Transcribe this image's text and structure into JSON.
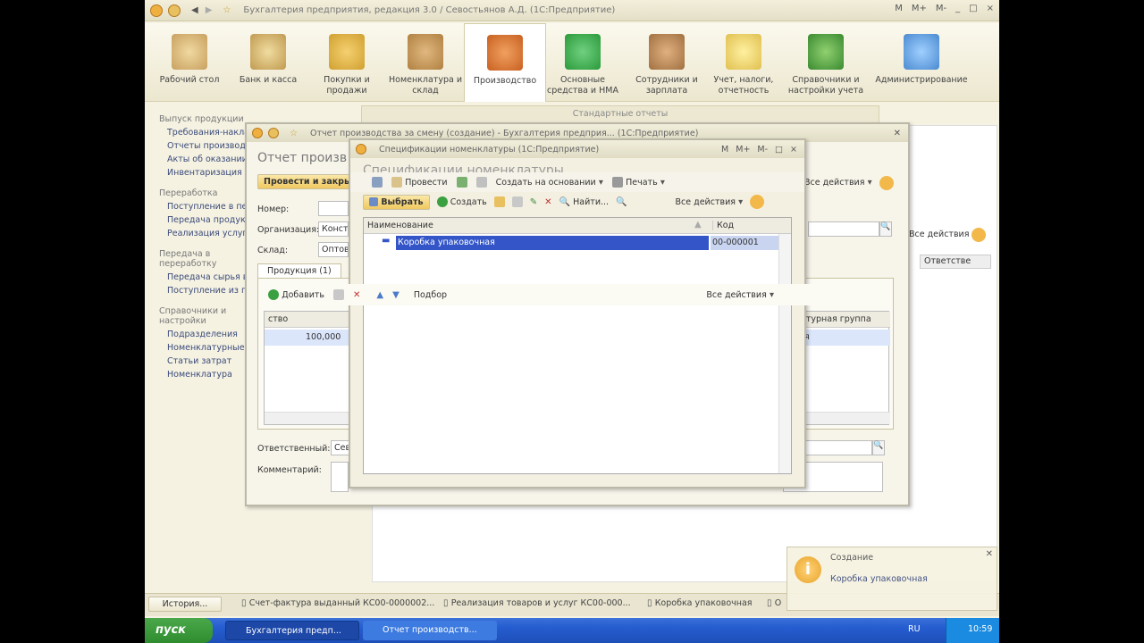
{
  "main_window": {
    "title": "Бухгалтерия предприятия, редакция 3.0 / Севостьянов А.Д. (1С:Предприятие)",
    "controls": [
      "M",
      "M+",
      "M-",
      "_",
      "□",
      "×"
    ]
  },
  "sections": [
    {
      "label": "Рабочий стол",
      "icon": "desk-icon",
      "color": "#c8a060"
    },
    {
      "label": "Банк и касса",
      "icon": "bank-icon",
      "color": "#c09a50"
    },
    {
      "label": "Покупки и продажи",
      "icon": "truck-icon",
      "color": "#d0a030"
    },
    {
      "label": "Номенклатура и склад",
      "icon": "warehouse-icon",
      "color": "#b08040"
    },
    {
      "label": "Производство",
      "icon": "production-icon",
      "color": "#c86020"
    },
    {
      "label": "Основные средства и НМА",
      "icon": "assets-icon",
      "color": "#2a9a3a"
    },
    {
      "label": "Сотрудники и зарплата",
      "icon": "employee-icon",
      "color": "#a07040"
    },
    {
      "label": "Учет, налоги, отчетность",
      "icon": "reports-icon",
      "color": "#e0c050"
    },
    {
      "label": "Справочники и настройки учета",
      "icon": "books-icon",
      "color": "#3a8a30"
    },
    {
      "label": "Администрирование",
      "icon": "admin-icon",
      "color": "#4a8ad0"
    }
  ],
  "nav": [
    {
      "heading": "Выпуск продукции",
      "items": [
        "Требования-накладные",
        "Отчеты производства",
        "Акты об оказании",
        "Инвентаризация"
      ]
    },
    {
      "heading": "Переработка",
      "items": [
        "Поступление в переработку",
        "Передача продукции",
        "Реализация услуг"
      ]
    },
    {
      "heading": "Передача в переработку",
      "items": [
        "Передача сырья в",
        "Поступление из п"
      ]
    },
    {
      "heading": "Справочники и настройки",
      "items": [
        "Подразделения",
        "Номенклатурные",
        "Статьи затрат",
        "Номенклатура"
      ]
    }
  ],
  "background_panel": {
    "title": "Стандартные отчеты",
    "all_actions": "Все действия",
    "col_responsible": "Ответстве"
  },
  "report_window": {
    "title": "Отчет производства за смену (создание) - Бухгалтерия предприя... (1С:Предприятие)",
    "heading": "Отчет произв",
    "post_close_btn": "Провести и закрыть",
    "all_actions": "Все действия",
    "number_label": "Номер:",
    "org_label": "Организация:",
    "org_value": "Конст",
    "warehouse_label": "Склад:",
    "warehouse_value": "Оптов",
    "tab_products": "Продукция (1)",
    "add_btn": "Добавить",
    "pick_btn": "Подбор",
    "table_all_actions": "Все действия",
    "col_qty": "ство",
    "col_group": "атурная группа",
    "row_qty": "100,000",
    "row_group": "я",
    "responsible_label": "Ответственный:",
    "responsible_value": "Сев",
    "comment_label": "Комментарий:"
  },
  "spec_window": {
    "title": "Спецификации номенклатуры (1С:Предприятие)",
    "heading": "Спецификации номенклатуры",
    "toolbar1": {
      "post": "Провести",
      "create_based": "Создать на основании",
      "print": "Печать"
    },
    "toolbar2": {
      "select": "Выбрать",
      "create": "Создать",
      "find": "Найти...",
      "all_actions": "Все действия"
    },
    "columns": [
      "Наименование",
      "Код"
    ],
    "rows": [
      {
        "name": "Коробка упаковочная",
        "code": "00-000001"
      }
    ]
  },
  "history_bar": {
    "button": "История...",
    "items": [
      "Счет-фактура выданный КС00-0000002...",
      "Реализация товаров и услуг КС00-000...",
      "Коробка упаковочная",
      "О"
    ]
  },
  "taskbar": {
    "start": "пуск",
    "tasks": [
      "Бухгалтерия предп...",
      "Отчет производств..."
    ],
    "lang": "RU",
    "time": "10:59"
  },
  "notification": {
    "title": "Создание",
    "text": "Коробка упаковочная"
  },
  "colors": {
    "selection": "#3355c8",
    "accent": "#f0b040",
    "taskbar": "#245ccf"
  }
}
